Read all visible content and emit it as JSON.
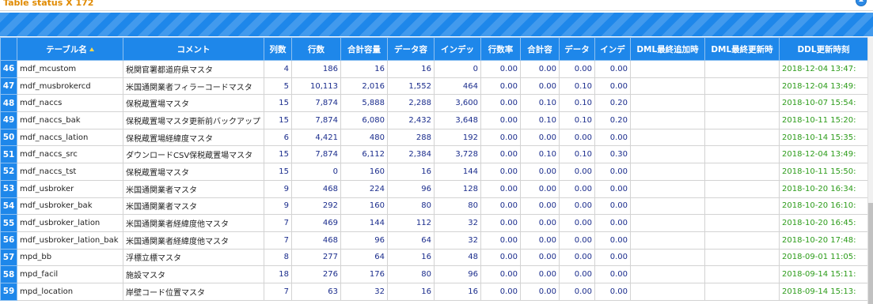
{
  "panel": {
    "title": "Table status X 172"
  },
  "table": {
    "headers": [
      "",
      "テーブル名",
      "コメント",
      "列数",
      "行数",
      "合計容量",
      "データ容",
      "インデッ",
      "行数率",
      "合計容",
      "データ",
      "インデ",
      "DML最終追加時",
      "DML最終更新時",
      "DDL更新時刻"
    ],
    "rows": [
      {
        "idx": "46",
        "name": "mdf_mcustom",
        "comment": "税関官署都道府県マスタ",
        "cols": "4",
        "rows": "186",
        "total": "16",
        "data": "16",
        "index": "0",
        "rate": "0.00",
        "t2": "0.00",
        "d2": "0.00",
        "i2": "0.00",
        "dml_add": "",
        "dml_upd": "",
        "ddl": "2018-12-04 13:47:"
      },
      {
        "idx": "47",
        "name": "mdf_musbrokercd",
        "comment": "米国通関業者フィラーコードマスタ",
        "cols": "5",
        "rows": "10,113",
        "total": "2,016",
        "data": "1,552",
        "index": "464",
        "rate": "0.00",
        "t2": "0.00",
        "d2": "0.10",
        "i2": "0.00",
        "dml_add": "",
        "dml_upd": "",
        "ddl": "2018-12-04 13:49:"
      },
      {
        "idx": "48",
        "name": "mdf_naccs",
        "comment": "保税蔵置場マスタ",
        "cols": "15",
        "rows": "7,874",
        "total": "5,888",
        "data": "2,288",
        "index": "3,600",
        "rate": "0.00",
        "t2": "0.10",
        "d2": "0.10",
        "i2": "0.20",
        "dml_add": "",
        "dml_upd": "",
        "ddl": "2018-10-07 15:54:"
      },
      {
        "idx": "49",
        "name": "mdf_naccs_bak",
        "comment": "保税蔵置場マスタ更新前バックアップ",
        "cols": "15",
        "rows": "7,874",
        "total": "6,080",
        "data": "2,432",
        "index": "3,648",
        "rate": "0.00",
        "t2": "0.10",
        "d2": "0.10",
        "i2": "0.20",
        "dml_add": "",
        "dml_upd": "",
        "ddl": "2018-10-11 15:20:"
      },
      {
        "idx": "50",
        "name": "mdf_naccs_lation",
        "comment": "保税蔵置場経緯度マスタ",
        "cols": "6",
        "rows": "4,421",
        "total": "480",
        "data": "288",
        "index": "192",
        "rate": "0.00",
        "t2": "0.00",
        "d2": "0.00",
        "i2": "0.00",
        "dml_add": "",
        "dml_upd": "",
        "ddl": "2018-10-14 15:35:"
      },
      {
        "idx": "51",
        "name": "mdf_naccs_src",
        "comment": "ダウンロードCSV保税蔵置場マスタ",
        "cols": "15",
        "rows": "7,874",
        "total": "6,112",
        "data": "2,384",
        "index": "3,728",
        "rate": "0.00",
        "t2": "0.10",
        "d2": "0.10",
        "i2": "0.30",
        "dml_add": "",
        "dml_upd": "",
        "ddl": "2018-12-04 13:49:"
      },
      {
        "idx": "52",
        "name": "mdf_naccs_tst",
        "comment": "保税蔵置場マスタ",
        "cols": "15",
        "rows": "0",
        "total": "160",
        "data": "16",
        "index": "144",
        "rate": "0.00",
        "t2": "0.00",
        "d2": "0.00",
        "i2": "0.00",
        "dml_add": "",
        "dml_upd": "",
        "ddl": "2018-10-11 15:50:"
      },
      {
        "idx": "53",
        "name": "mdf_usbroker",
        "comment": "米国通関業者マスタ",
        "cols": "9",
        "rows": "468",
        "total": "224",
        "data": "96",
        "index": "128",
        "rate": "0.00",
        "t2": "0.00",
        "d2": "0.00",
        "i2": "0.00",
        "dml_add": "",
        "dml_upd": "",
        "ddl": "2018-10-20 16:34:"
      },
      {
        "idx": "54",
        "name": "mdf_usbroker_bak",
        "comment": "米国通関業者マスタ",
        "cols": "9",
        "rows": "292",
        "total": "160",
        "data": "80",
        "index": "80",
        "rate": "0.00",
        "t2": "0.00",
        "d2": "0.00",
        "i2": "0.00",
        "dml_add": "",
        "dml_upd": "",
        "ddl": "2018-10-20 16:10:"
      },
      {
        "idx": "55",
        "name": "mdf_usbroker_lation",
        "comment": "米国通関業者経緯度他マスタ",
        "cols": "7",
        "rows": "469",
        "total": "144",
        "data": "112",
        "index": "32",
        "rate": "0.00",
        "t2": "0.00",
        "d2": "0.00",
        "i2": "0.00",
        "dml_add": "",
        "dml_upd": "",
        "ddl": "2018-10-20 16:45:"
      },
      {
        "idx": "56",
        "name": "mdf_usbroker_lation_bak",
        "comment": "米国通関業者経緯度他マスタ",
        "cols": "7",
        "rows": "468",
        "total": "96",
        "data": "64",
        "index": "32",
        "rate": "0.00",
        "t2": "0.00",
        "d2": "0.00",
        "i2": "0.00",
        "dml_add": "",
        "dml_upd": "",
        "ddl": "2018-10-20 17:48:"
      },
      {
        "idx": "57",
        "name": "mpd_bb",
        "comment": "浮標立標マスタ",
        "cols": "8",
        "rows": "277",
        "total": "64",
        "data": "16",
        "index": "48",
        "rate": "0.00",
        "t2": "0.00",
        "d2": "0.00",
        "i2": "0.00",
        "dml_add": "",
        "dml_upd": "",
        "ddl": "2018-09-01 11:05:"
      },
      {
        "idx": "58",
        "name": "mpd_facil",
        "comment": "施設マスタ",
        "cols": "18",
        "rows": "276",
        "total": "176",
        "data": "80",
        "index": "96",
        "rate": "0.00",
        "t2": "0.00",
        "d2": "0.00",
        "i2": "0.00",
        "dml_add": "",
        "dml_upd": "",
        "ddl": "2018-09-14 15:11:"
      },
      {
        "idx": "59",
        "name": "mpd_location",
        "comment": "岸壁コード位置マスタ",
        "cols": "7",
        "rows": "63",
        "total": "32",
        "data": "16",
        "index": "16",
        "rate": "0.00",
        "t2": "0.00",
        "d2": "0.00",
        "i2": "0.00",
        "dml_add": "",
        "dml_upd": "",
        "ddl": "2018-09-14 15:13:"
      }
    ]
  }
}
